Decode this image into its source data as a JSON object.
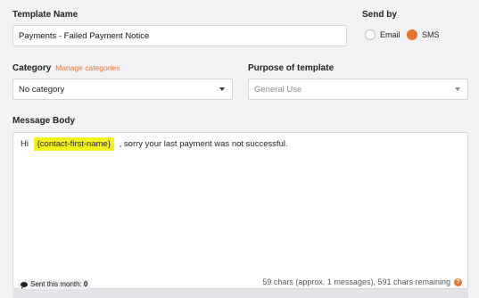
{
  "template_name": {
    "label": "Template Name",
    "value": "Payments - Failed Payment Notice"
  },
  "send_by": {
    "label": "Send by",
    "options": [
      {
        "label": "Email",
        "selected": false
      },
      {
        "label": "SMS",
        "selected": true
      }
    ],
    "accent_color": "#e8742c"
  },
  "category": {
    "label": "Category",
    "manage_link": "Manage categories",
    "value": "No category"
  },
  "purpose": {
    "label": "Purpose of template",
    "value": "General Use"
  },
  "message": {
    "label": "Message Body",
    "text_before": "Hi",
    "merge_tag": "{contact-first-name}",
    "text_after": ", sorry your last payment was not successful.",
    "tag_color": "#f5f31d"
  },
  "footer": {
    "sent_label": "Sent this month:",
    "sent_count": "0",
    "char_info": "59 chars (approx. 1 messages), 591 chars remaining",
    "help_icon": "question-icon"
  }
}
